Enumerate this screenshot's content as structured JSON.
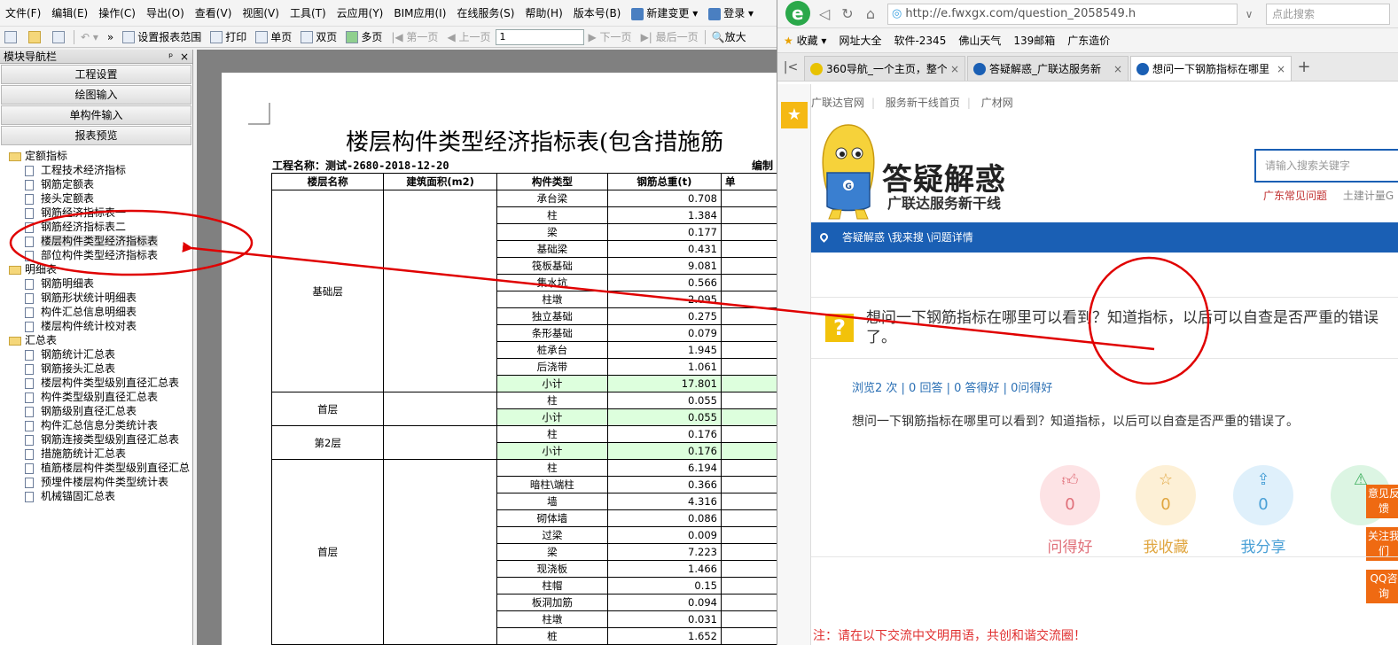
{
  "app": {
    "menu": [
      {
        "label": "文件(F)"
      },
      {
        "label": "编辑(E)"
      },
      {
        "label": "操作(C)"
      },
      {
        "label": "导出(O)"
      },
      {
        "label": "查看(V)"
      },
      {
        "label": "视图(V)"
      },
      {
        "label": "工具(T)"
      },
      {
        "label": "云应用(Y)"
      },
      {
        "label": "BIM应用(I)"
      },
      {
        "label": "在线服务(S)"
      },
      {
        "label": "帮助(H)"
      },
      {
        "label": "版本号(B)"
      },
      {
        "label": "新建变更 ▾"
      },
      {
        "label": "登录 ▾"
      }
    ],
    "toolbar": {
      "set_range": "设置报表范围",
      "print": "打印",
      "single_page": "单页",
      "double_page": "双页",
      "multi_page": "多页",
      "first_page": "第一页",
      "prev_page": "上一页",
      "page_value": "1",
      "next_page": "下一页",
      "last_page": "最后一页",
      "zoom_in": "放大"
    },
    "nav": {
      "title": "模块导航栏",
      "pin": "ᵖ",
      "close": "×",
      "buttons": [
        "工程设置",
        "绘图输入",
        "单构件输入",
        "报表预览"
      ],
      "tree": [
        {
          "type": "folder",
          "label": "定额指标"
        },
        {
          "type": "leaf",
          "label": "工程技术经济指标"
        },
        {
          "type": "leaf",
          "label": "钢筋定额表"
        },
        {
          "type": "leaf",
          "label": "接头定额表"
        },
        {
          "type": "leaf",
          "label": "钢筋经济指标表一"
        },
        {
          "type": "leaf",
          "label": "钢筋经济指标表二"
        },
        {
          "type": "leaf",
          "label": "楼层构件类型经济指标表",
          "selected": true
        },
        {
          "type": "leaf",
          "label": "部位构件类型经济指标表"
        },
        {
          "type": "folder",
          "label": "明细表"
        },
        {
          "type": "leaf",
          "label": "钢筋明细表"
        },
        {
          "type": "leaf",
          "label": "钢筋形状统计明细表"
        },
        {
          "type": "leaf",
          "label": "构件汇总信息明细表"
        },
        {
          "type": "leaf",
          "label": "楼层构件统计校对表"
        },
        {
          "type": "folder",
          "label": "汇总表"
        },
        {
          "type": "leaf",
          "label": "钢筋统计汇总表"
        },
        {
          "type": "leaf",
          "label": "钢筋接头汇总表"
        },
        {
          "type": "leaf",
          "label": "楼层构件类型级别直径汇总表"
        },
        {
          "type": "leaf",
          "label": "构件类型级别直径汇总表"
        },
        {
          "type": "leaf",
          "label": "钢筋级别直径汇总表"
        },
        {
          "type": "leaf",
          "label": "构件汇总信息分类统计表"
        },
        {
          "type": "leaf",
          "label": "钢筋连接类型级别直径汇总表"
        },
        {
          "type": "leaf",
          "label": "措施筋统计汇总表"
        },
        {
          "type": "leaf",
          "label": "植筋楼层构件类型级别直径汇总"
        },
        {
          "type": "leaf",
          "label": "预埋件楼层构件类型统计表"
        },
        {
          "type": "leaf",
          "label": "机械锚固汇总表"
        }
      ]
    },
    "report": {
      "title": "楼层构件类型经济指标表(包含措施筋",
      "project": "工程名称：测试-2680-2018-12-20",
      "editor": "编制",
      "headers": [
        "楼层名称",
        "建筑面积(m2)",
        "构件类型",
        "钢筋总重(t)",
        "单"
      ],
      "groups": [
        {
          "floor": "基础层",
          "rows": [
            {
              "type": "承台梁",
              "weight": "0.708"
            },
            {
              "type": "柱",
              "weight": "1.384"
            },
            {
              "type": "梁",
              "weight": "0.177"
            },
            {
              "type": "基础梁",
              "weight": "0.431"
            },
            {
              "type": "筏板基础",
              "weight": "9.081"
            },
            {
              "type": "集水坑",
              "weight": "0.566"
            },
            {
              "type": "柱墩",
              "weight": "2.095"
            },
            {
              "type": "独立基础",
              "weight": "0.275"
            },
            {
              "type": "条形基础",
              "weight": "0.079"
            },
            {
              "type": "桩承台",
              "weight": "1.945"
            },
            {
              "type": "后浇带",
              "weight": "1.061"
            },
            {
              "type": "小计",
              "weight": "17.801",
              "subtotal": true
            }
          ]
        },
        {
          "floor": "首层",
          "rows": [
            {
              "type": "柱",
              "weight": "0.055"
            },
            {
              "type": "小计",
              "weight": "0.055",
              "subtotal": true
            }
          ]
        },
        {
          "floor": "第2层",
          "rows": [
            {
              "type": "柱",
              "weight": "0.176"
            },
            {
              "type": "小计",
              "weight": "0.176",
              "subtotal": true
            }
          ]
        },
        {
          "floor": "首层",
          "rows": [
            {
              "type": "柱",
              "weight": "6.194"
            },
            {
              "type": "暗柱\\端柱",
              "weight": "0.366"
            },
            {
              "type": "墙",
              "weight": "4.316"
            },
            {
              "type": "砌体墙",
              "weight": "0.086"
            },
            {
              "type": "过梁",
              "weight": "0.009"
            },
            {
              "type": "梁",
              "weight": "7.223"
            },
            {
              "type": "现浇板",
              "weight": "1.466"
            },
            {
              "type": "柱帽",
              "weight": "0.15"
            },
            {
              "type": "板洞加筋",
              "weight": "0.094"
            },
            {
              "type": "柱墩",
              "weight": "0.031"
            },
            {
              "type": "桩",
              "weight": "1.652"
            }
          ]
        }
      ]
    }
  },
  "browser": {
    "url": "http://e.fwxgx.com/question_2058549.h",
    "search_placeholder": "点此搜索",
    "favorites": [
      "收藏 ▾",
      "网址大全",
      "软件-2345",
      "佛山天气",
      "139邮箱",
      "广东造价"
    ],
    "tabs": [
      {
        "title": "360导航_一个主页，整个"
      },
      {
        "title": "答疑解惑_广联达服务新"
      },
      {
        "title": "想问一下钢筋指标在哪里",
        "active": true
      }
    ],
    "page": {
      "toplinks": [
        "广联达官网",
        "服务新干线首页",
        "广材网"
      ],
      "brand_title": "答疑解惑",
      "brand_sub": "广联达服务新干线",
      "search_placeholder": "请输入搜索关键字",
      "hot_link_1": "广东常见问题",
      "hot_link_2": "土建计量G",
      "breadcrumb": "答疑解惑 \\我来搜 \\问题详情",
      "question_title": "想问一下钢筋指标在哪里可以看到？知道指标，以后可以自查是否严重的错误了。",
      "stats": "浏览2 次 | 0 回答 | 0 答得好 | 0问得好",
      "question_body": "想问一下钢筋指标在哪里可以看到？知道指标，以后可以自查是否严重的错误了。",
      "actions": [
        {
          "label": "问得好",
          "count": "0"
        },
        {
          "label": "我收藏",
          "count": "0"
        },
        {
          "label": "我分享",
          "count": "0"
        },
        {
          "label": "报"
        }
      ],
      "side_buttons": [
        "意见反馈",
        "关注我们",
        "QQ咨询"
      ],
      "notice": "注：请在以下交流中文明用语，共创和谐交流圈！"
    }
  },
  "colors": {
    "annotation_red": "#e00000",
    "brand_blue": "#1a5fb4",
    "subtotal_green": "#ddffdd",
    "side_button_orange": "#ef6a12"
  }
}
